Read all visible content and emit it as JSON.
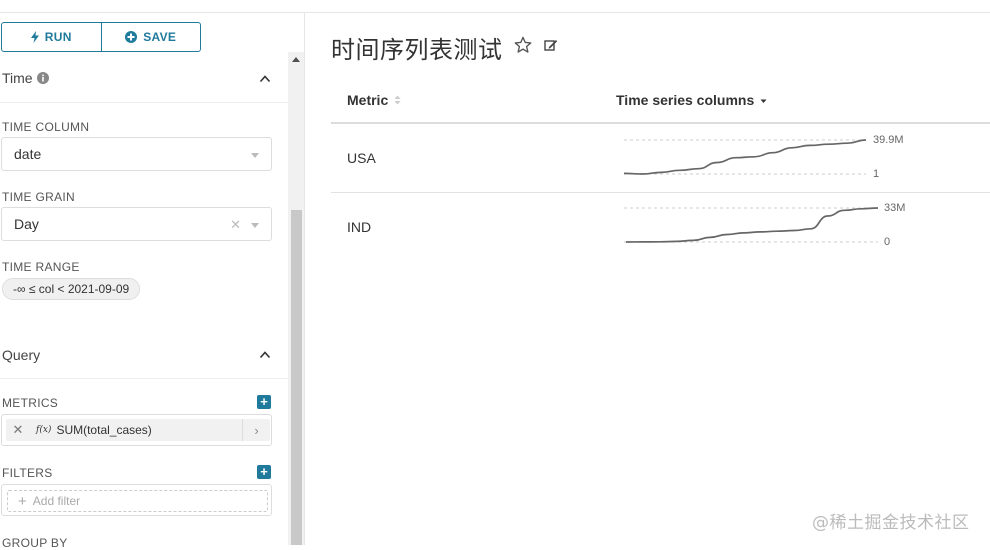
{
  "toolbar": {
    "run_label": "RUN",
    "save_label": "SAVE"
  },
  "time_section": {
    "title": "Time",
    "time_column": {
      "label": "TIME COLUMN",
      "value": "date"
    },
    "time_grain": {
      "label": "TIME GRAIN",
      "value": "Day"
    },
    "time_range": {
      "label": "TIME RANGE",
      "value": "-∞ ≤ col < 2021-09-09"
    }
  },
  "query_section": {
    "title": "Query",
    "metrics": {
      "label": "METRICS",
      "items": [
        {
          "fx": "f(x)",
          "value": "SUM(total_cases)"
        }
      ]
    },
    "filters": {
      "label": "FILTERS",
      "placeholder": "Add filter"
    },
    "group_by": {
      "label": "GROUP BY"
    }
  },
  "chart": {
    "title": "时间序列表测试",
    "columns": {
      "metric": "Metric",
      "time_series": "Time series columns"
    },
    "rows": [
      {
        "metric": "USA",
        "max_label": "39.9M",
        "min_label": "1",
        "series": [
          1,
          0.3,
          2.2,
          4.6,
          6.5,
          13.7,
          19.3,
          20.3,
          25.1,
          30.8,
          33.6,
          35.0,
          36.2,
          39.9
        ]
      },
      {
        "metric": "IND",
        "max_label": "33M",
        "min_label": "0",
        "series": [
          0,
          0.05,
          0.2,
          0.6,
          1.6,
          4.5,
          7.3,
          8.8,
          9.8,
          10.5,
          11.2,
          12.8,
          25.2,
          30.8,
          32.2,
          33.0
        ]
      }
    ]
  },
  "watermark": "@稀土掘金技术社区",
  "colors": {
    "accent": "#1f7a9c",
    "sparkline": "#666666"
  }
}
